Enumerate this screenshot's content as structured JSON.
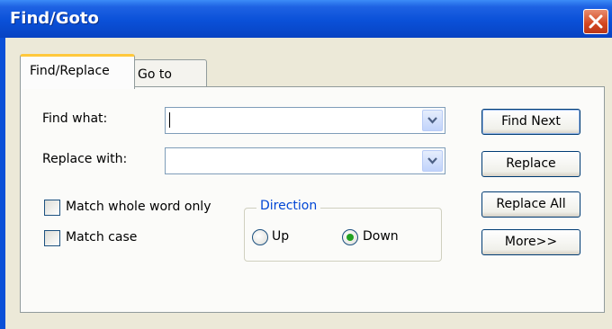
{
  "window": {
    "title": "Find/Goto"
  },
  "tabs": [
    {
      "label": "Find/Replace",
      "active": true
    },
    {
      "label": "Go to",
      "active": false
    }
  ],
  "find": {
    "label": "Find what:",
    "value": ""
  },
  "replace": {
    "label": "Replace with:",
    "value": ""
  },
  "options": {
    "match_whole_word": {
      "label": "Match whole word only",
      "checked": false
    },
    "match_case": {
      "label": "Match case",
      "checked": false
    }
  },
  "direction": {
    "legend": "Direction",
    "up_label": "Up",
    "down_label": "Down",
    "selected": "Down"
  },
  "buttons": {
    "find_next": "Find Next",
    "replace": "Replace",
    "replace_all": "Replace All",
    "more": "More>>"
  },
  "icons": {
    "close": "close-icon",
    "dropdown": "chevron-down-icon"
  },
  "colors": {
    "titlebar": "#0A50D8",
    "accent_tab": "#FFC83C",
    "direction_legend": "#0046D5",
    "radio_selected": "#21A121"
  }
}
